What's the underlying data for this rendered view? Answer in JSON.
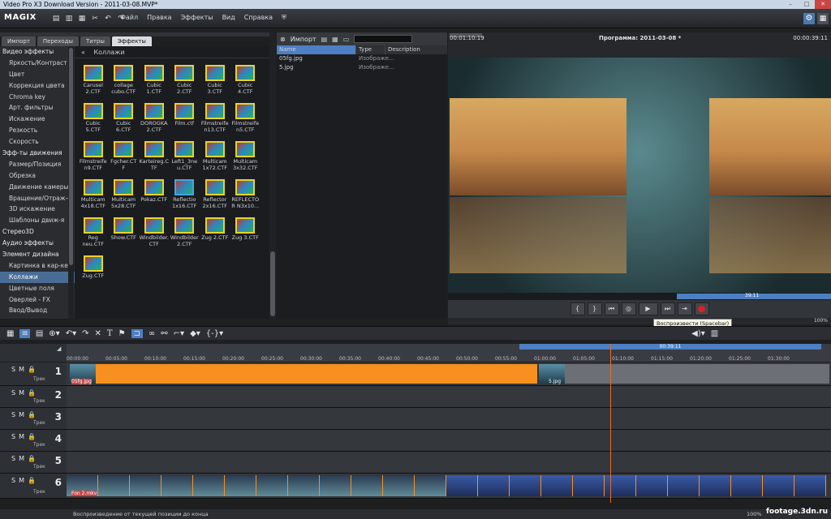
{
  "window": {
    "title": "Video Pro X3 Download Version - 2011-03-08.MVP*"
  },
  "app": {
    "logo": "MAGIX"
  },
  "menu": [
    "Файл",
    "Правка",
    "Эффекты",
    "Вид",
    "Справка"
  ],
  "tabs": [
    "Импорт",
    "Переходы",
    "Титры",
    "Эффекты"
  ],
  "categories": [
    {
      "label": "Видео эффекты",
      "head": true
    },
    {
      "label": "Яркость/Контраст"
    },
    {
      "label": "Цвет"
    },
    {
      "label": "Коррекция цвета"
    },
    {
      "label": "Chroma key"
    },
    {
      "label": "Арт. фильтры"
    },
    {
      "label": "Искажение"
    },
    {
      "label": "Резкость"
    },
    {
      "label": "Скорость"
    },
    {
      "label": "Эфф-ты движения",
      "head": true
    },
    {
      "label": "Размер/Позиция"
    },
    {
      "label": "Обрезка"
    },
    {
      "label": "Движение камеры"
    },
    {
      "label": "Вращение/Отраж-е"
    },
    {
      "label": "3D искажение"
    },
    {
      "label": "Шаблоны движ-я"
    },
    {
      "label": "Стерео3D",
      "head": true
    },
    {
      "label": "Аудио эффекты",
      "head": true
    },
    {
      "label": "Элемент дизайна",
      "head": true
    },
    {
      "label": "Картинка в кар-ке"
    },
    {
      "label": "Коллажи",
      "selected": true
    },
    {
      "label": "Цветные поля"
    },
    {
      "label": "Оверлей - FX"
    },
    {
      "label": "Ввод/Вывод"
    }
  ],
  "effects": {
    "breadcrumb": "Коллажи",
    "items": [
      "Carusel 2.CTF",
      "collage cubo.CTF",
      "Cubic 1.CTF",
      "Cubic 2.CTF",
      "Cubic 3.CTF",
      "Cubic 4.CTF",
      "Cubic 5.CTF",
      "Cubic 6.CTF",
      "DOROGKA 2.CTF",
      "Film.ctf",
      "Filmstreife n13.CTF",
      "Filmstreife n5.CTF",
      "Filmstreife n9.CTF",
      "Fgcher.CT F",
      "Karteireg.C TF",
      "Left1_3ne u.CTF",
      "Multicam 1x72.CTF",
      "Multicam 3x32.CTF",
      "Multicam 4x18.CTF",
      "Multicam 5x28.CTF",
      "Pokaz.CTF",
      "Reflectio 1x16.CTF",
      "Reflector 2x16.CTF",
      "REFLECTO R N3x10...",
      "Reg neu.CTF",
      "Show.CTF",
      "Windbilder. CTF",
      "Windbilder 2.CTF",
      "Zug 2.CTF",
      "Zug 3.CTF",
      "Zug.CTF"
    ],
    "selected_index": 21
  },
  "browser": {
    "title": "Импорт",
    "columns": [
      "Name",
      "Type",
      "Description"
    ],
    "rows": [
      {
        "name": "05fg.jpg",
        "type": "Изображе..."
      },
      {
        "name": "5.jpg",
        "type": "Изображе..."
      }
    ]
  },
  "monitor": {
    "time_left": "00:01:10:19",
    "title": "Программа: 2011-03-08 *",
    "time_right": "00:00:39:11",
    "position": "39:11",
    "zoom": "100%"
  },
  "tooltip": "Воспроизвести (Spacebar)",
  "timeline": {
    "range_label": "00:39:11",
    "ticks": [
      "00:00:00",
      "00:05:00",
      "00:10:00",
      "00:15:00",
      "00:20:00",
      "00:25:00",
      "00:30:00",
      "00:35:00",
      "00:40:00",
      "00:45:00",
      "00:50:00",
      "00:55:00",
      "01:00:00",
      "01:05:00",
      "01:10:00",
      "01:15:00",
      "01:20:00",
      "01:25:00",
      "01:30:00"
    ],
    "track_label": "Трек",
    "tracks": [
      "1",
      "2",
      "3",
      "4",
      "5",
      "6"
    ],
    "clip1_name": "05fg.jpg",
    "clip6_name": "Fon 2.mkv",
    "clip1b_name": "5.jpg"
  },
  "status": {
    "text": "Воспроизведение от текущей позиции до конца",
    "zoom": "100%"
  },
  "watermark": "footage.3dn.ru",
  "colors": {
    "accent": "#4d7fc2",
    "clip_orange": "#f7901e",
    "playhead": "#e06c2d"
  }
}
